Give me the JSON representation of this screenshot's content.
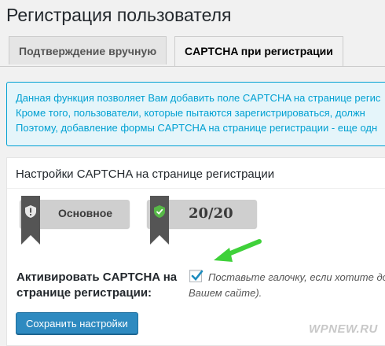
{
  "page": {
    "title": "Регистрация пользователя"
  },
  "tabs": [
    {
      "label": "Подтверждение вручную",
      "active": false
    },
    {
      "label": "CAPTCHA при регистрации",
      "active": true
    }
  ],
  "notice": {
    "lines": [
      "Данная функция позволяет Вам добавить поле CAPTCHA на странице регис",
      "Кроме того, пользователи, которые пытаются зарегистрироваться, должн",
      "Поэтому, добавление формы CAPTCHA на странице регистрации - еще одн"
    ]
  },
  "postbox": {
    "title": "Настройки CAPTCHA на странице регистрации",
    "badges": [
      {
        "label": "Основное",
        "icon": "shield-alert-icon",
        "ribbon_color": "#555555"
      },
      {
        "label": "20/20",
        "icon": "shield-check-icon",
        "ribbon_color": "#555555"
      }
    ],
    "setting": {
      "label": "Активировать CAPTCHA на странице регистрации:",
      "checked": true,
      "description_line1": "Поставьте галочку, если хотите до",
      "description_line2": "Вашем сайте)."
    },
    "save_label": "Сохранить настройки"
  },
  "watermark": "WPNEW.RU",
  "colors": {
    "notice_bg": "#e5f5fa",
    "notice_text": "#00a0d2",
    "button": "#2e8ac0",
    "arrow": "#3fd13a"
  }
}
